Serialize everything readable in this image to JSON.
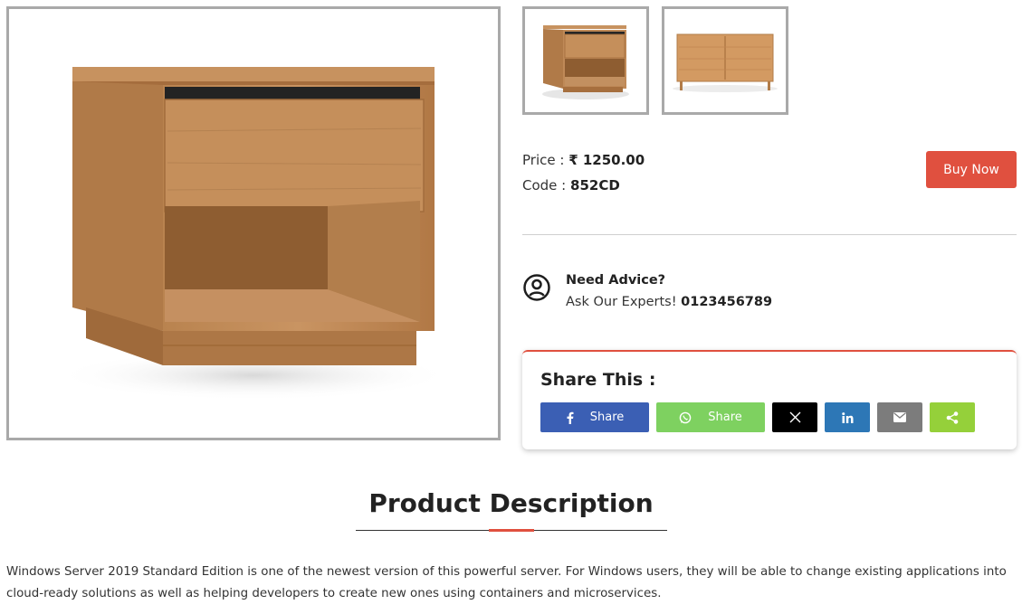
{
  "product": {
    "price_label": "Price :",
    "price_value": "₹ 1250.00",
    "code_label": "Code :",
    "code_value": "852CD"
  },
  "actions": {
    "buy_label": "Buy Now"
  },
  "advice": {
    "title": "Need Advice?",
    "text": "Ask Our Experts!",
    "phone": "0123456789",
    "icon": "user-circle-icon"
  },
  "share": {
    "title": "Share This :",
    "facebook_label": "Share",
    "whatsapp_label": "Share",
    "colors": {
      "facebook": "#3b5fb4",
      "whatsapp": "#7ed160",
      "x": "#000000",
      "linkedin": "#2d77b6",
      "email": "#7c7c7c",
      "sharethis": "#95d03a"
    }
  },
  "description": {
    "title": "Product Description",
    "text": "Windows Server 2019 Standard Edition is one of the newest version of this powerful server. For Windows users, they will be able to change existing applications into cloud-ready solutions as well as helping developers to create new ones using containers and microservices."
  },
  "colors": {
    "accent": "#e0503f",
    "border": "#a9a9a9"
  }
}
